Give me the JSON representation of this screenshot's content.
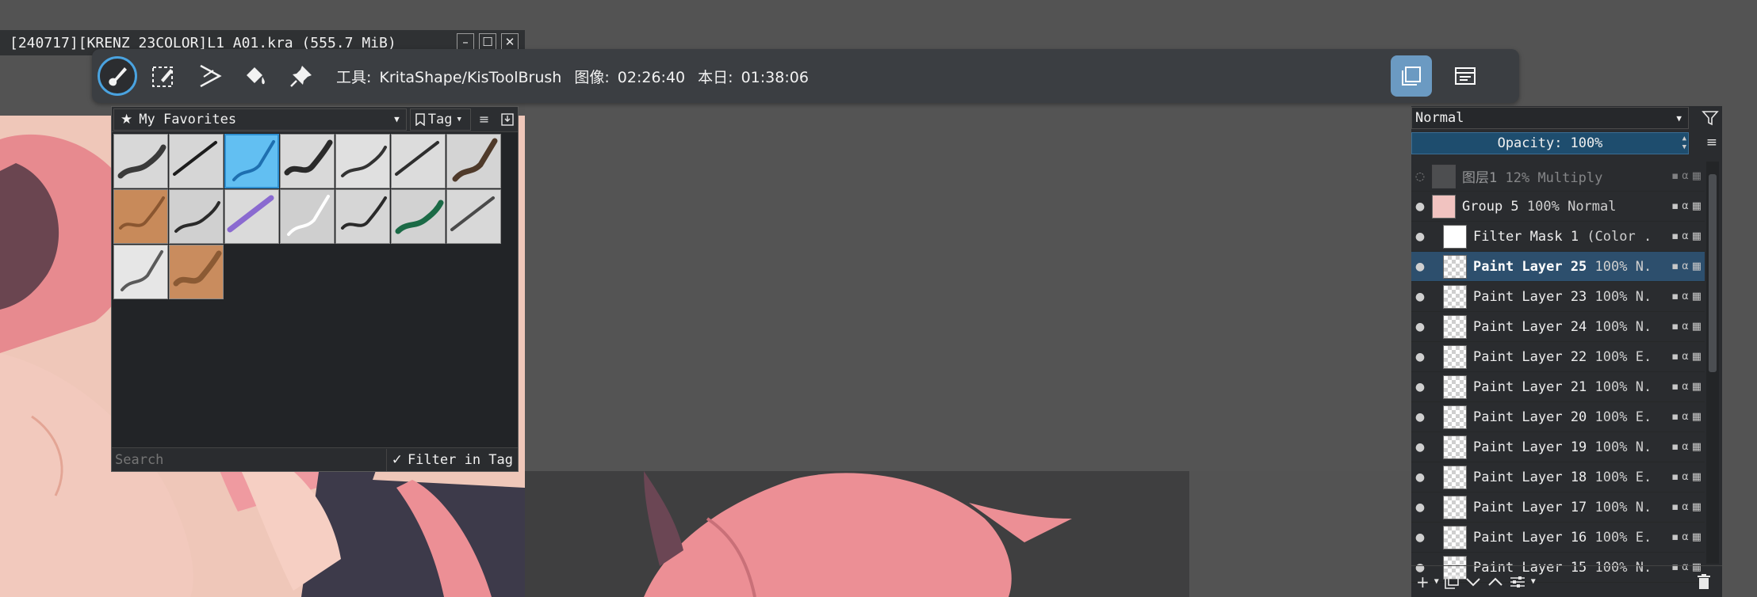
{
  "document": {
    "title": "[240717][KRENZ 23COLOR]L1 A01.kra (555.7 MiB)",
    "controls": [
      "–",
      "☐",
      "✕"
    ]
  },
  "toolbar": {
    "tools": [
      {
        "name": "freehand-brush-icon",
        "active": true
      },
      {
        "name": "edit-shapes-icon",
        "active": false
      },
      {
        "name": "assistant-tool-icon",
        "active": false
      },
      {
        "name": "fill-bucket-icon",
        "active": false
      },
      {
        "name": "pin-icon",
        "active": false
      }
    ],
    "tool_label": "工具:",
    "tool_value": "KritaShape/KisToolBrush",
    "image_label": "图像:",
    "image_value": "02:26:40",
    "today_label": "本日:",
    "today_value": "01:38:06",
    "right_buttons": [
      {
        "name": "canvas-only-icon",
        "active": true
      },
      {
        "name": "docker-toggle-icon",
        "active": false
      }
    ]
  },
  "presets": {
    "favorite_label": "My Favorites",
    "tag_label": "Tag",
    "search_placeholder": "Search",
    "filter_in_tag_label": "Filter in Tag",
    "filter_checked": true,
    "items": [
      {
        "name": "airbrush-soft",
        "bg": "#d8d8d8",
        "stroke": "#3a3a3a",
        "selected": false
      },
      {
        "name": "ink-pen",
        "bg": "#d6d6d6",
        "stroke": "#1c1c1c",
        "selected": false
      },
      {
        "name": "blue-marker",
        "bg": "#62bff2",
        "stroke": "#1e6fb0",
        "selected": true
      },
      {
        "name": "sketch-pen",
        "bg": "#d9d9d9",
        "stroke": "#2a2a2a",
        "selected": false
      },
      {
        "name": "fine-liner",
        "bg": "#e0e0e0",
        "stroke": "#333333",
        "selected": false
      },
      {
        "name": "calligraphy-pen",
        "bg": "#dcdcdc",
        "stroke": "#2e2e2e",
        "selected": false
      },
      {
        "name": "pencil-brown",
        "bg": "#d4d4d4",
        "stroke": "#4f3a2a",
        "selected": false
      },
      {
        "name": "texture-orange",
        "bg": "#c88a5a",
        "stroke": "#8a5630",
        "selected": false
      },
      {
        "name": "bristle-dark",
        "bg": "#d0d0d0",
        "stroke": "#2a2a2a",
        "selected": false
      },
      {
        "name": "watercolor-purple",
        "bg": "#dadada",
        "stroke": "#8a6ad0",
        "selected": false
      },
      {
        "name": "soft-white",
        "bg": "#cfcfcf",
        "stroke": "#ffffff",
        "selected": false
      },
      {
        "name": "chemistry-flask",
        "bg": "#d6d6d6",
        "stroke": "#2a2a2a",
        "selected": false
      },
      {
        "name": "green-pattern",
        "bg": "#d2d2d2",
        "stroke": "#1b6a46",
        "selected": false
      },
      {
        "name": "grey-smudge",
        "bg": "#d8d8d8",
        "stroke": "#4a4a4a",
        "selected": false
      },
      {
        "name": "grey-blend",
        "bg": "#e6e6e6",
        "stroke": "#5a5a5a",
        "selected": false
      },
      {
        "name": "texture-orange-2",
        "bg": "#c98c5e",
        "stroke": "#8b5a34",
        "selected": false
      }
    ]
  },
  "layers": {
    "blend_mode": "Normal",
    "opacity_label": "Opacity:",
    "opacity_value": "100%",
    "rows": [
      {
        "name": "图层1",
        "meta": "12% Multiply",
        "indent": 0,
        "thumb": "grey",
        "active": false,
        "dim": true,
        "bold": false
      },
      {
        "name": "Group 5",
        "meta": "100% Normal",
        "indent": 0,
        "thumb": "pink",
        "active": false,
        "dim": false,
        "bold": false
      },
      {
        "name": "Filter Mask 1",
        "meta": "(Color ...",
        "indent": 1,
        "thumb": "white",
        "active": false,
        "dim": false,
        "bold": false
      },
      {
        "name": "Paint Layer 25",
        "meta": "100% N...",
        "indent": 1,
        "thumb": "checker",
        "active": true,
        "dim": false,
        "bold": true
      },
      {
        "name": "Paint Layer 23",
        "meta": "100% N...",
        "indent": 1,
        "thumb": "checker",
        "active": false,
        "dim": false,
        "bold": false
      },
      {
        "name": "Paint Layer 24",
        "meta": "100% N...",
        "indent": 1,
        "thumb": "checker",
        "active": false,
        "dim": false,
        "bold": false
      },
      {
        "name": "Paint Layer 22",
        "meta": "100% E...",
        "indent": 1,
        "thumb": "checker",
        "active": false,
        "dim": false,
        "bold": false
      },
      {
        "name": "Paint Layer 21",
        "meta": "100% N...",
        "indent": 1,
        "thumb": "checker",
        "active": false,
        "dim": false,
        "bold": false
      },
      {
        "name": "Paint Layer 20",
        "meta": "100% E...",
        "indent": 1,
        "thumb": "checker",
        "active": false,
        "dim": false,
        "bold": false
      },
      {
        "name": "Paint Layer 19",
        "meta": "100% N...",
        "indent": 1,
        "thumb": "checker",
        "active": false,
        "dim": false,
        "bold": false
      },
      {
        "name": "Paint Layer 18",
        "meta": "100% E...",
        "indent": 1,
        "thumb": "checker",
        "active": false,
        "dim": false,
        "bold": false
      },
      {
        "name": "Paint Layer 17",
        "meta": "100% N...",
        "indent": 1,
        "thumb": "checker",
        "active": false,
        "dim": false,
        "bold": false
      },
      {
        "name": "Paint Layer 16",
        "meta": "100% E...",
        "indent": 1,
        "thumb": "checker",
        "active": false,
        "dim": false,
        "bold": false
      },
      {
        "name": "Paint Layer 15",
        "meta": "100% N...",
        "indent": 1,
        "thumb": "checker",
        "active": false,
        "dim": false,
        "bold": false
      }
    ]
  }
}
